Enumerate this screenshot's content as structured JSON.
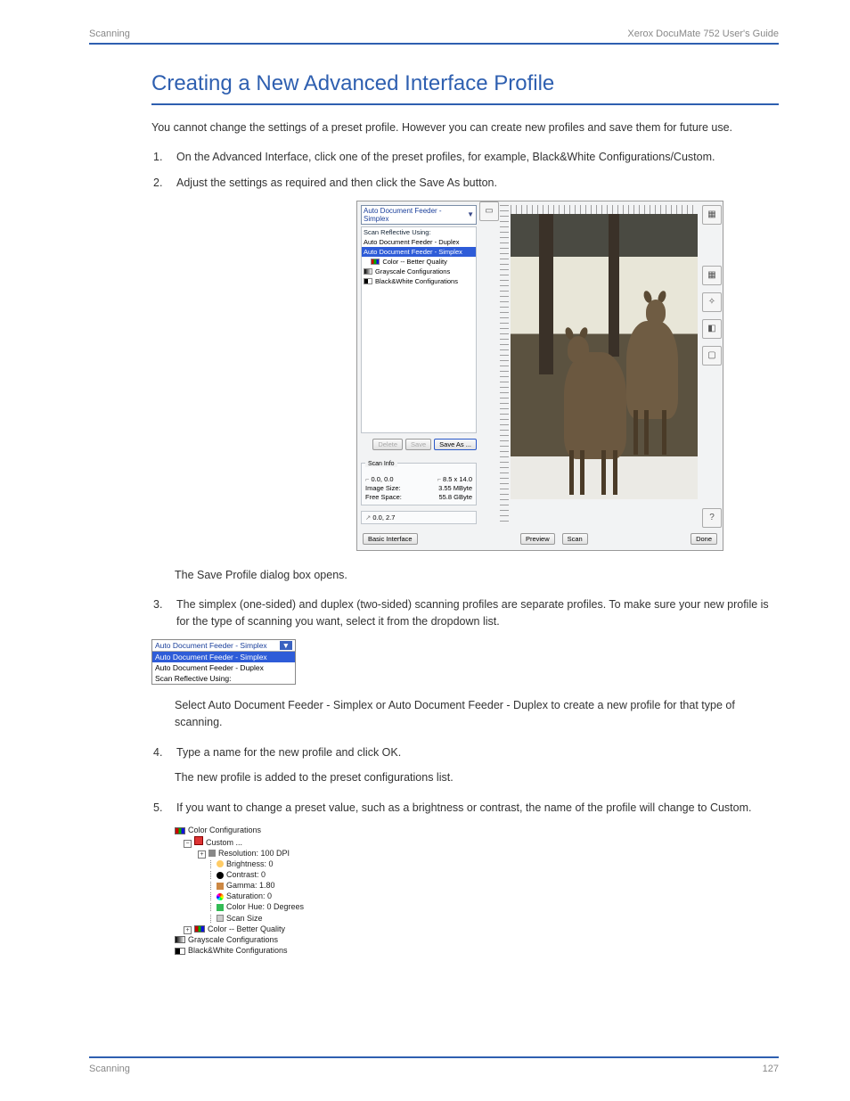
{
  "header": {
    "left": "Scanning",
    "right": "Xerox DocuMate 752 User's Guide"
  },
  "section_title": "Creating a New Advanced Interface Profile",
  "intro": "You cannot change the settings of a preset profile. However you can create new profiles and save them for future use.",
  "step1": "On the Advanced Interface, click one of the preset profiles, for example, Black&White Configurations/Custom.",
  "step2": "Adjust the settings as required and then click the Save As button.",
  "after_shot": "The Save Profile dialog box opens.",
  "step3_a": "The simplex (one-sided) and duplex (two-sided) scanning profiles are separate profiles. To make sure your new profile is for the type of scanning you want, select it from the dropdown list.",
  "step3_b": "Select Auto Document Feeder - Simplex or Auto Document Feeder - Duplex to create a new profile for that type of scanning.",
  "step4": "Type a name for the new profile and click OK.",
  "step4_after": "The new profile is added to the preset configurations list.",
  "step5": "If you want to change a preset value, such as a brightness or contrast, the name of the profile will change to Custom.",
  "footer": {
    "left": "Scanning",
    "right": "127"
  },
  "shot": {
    "combo_value": "Auto Document Feeder - Simplex",
    "list": {
      "header": "Scan Reflective Using:",
      "r1": "Auto Document Feeder - Duplex",
      "sel": "Auto Document Feeder - Simplex",
      "r2": "Color -- Better Quality",
      "r3": "Grayscale Configurations",
      "r4": "Black&White Configurations"
    },
    "btn_delete": "Delete",
    "btn_save": "Save",
    "btn_saveas": "Save As ...",
    "scaninfo_title": "Scan Info",
    "origin": "0.0, 0.0",
    "dims": "8.5 x 14.0",
    "imgsize_label": "Image Size:",
    "imgsize": "3.55 MByte",
    "free_label": "Free Space:",
    "free": "55.8 GByte",
    "cursor": "0.0, 2.7",
    "btn_basic": "Basic Interface",
    "btn_preview": "Preview",
    "btn_scan": "Scan",
    "btn_done": "Done"
  },
  "mini": {
    "header": "Auto Document Feeder - Simplex",
    "r1": "Auto Document Feeder - Simplex",
    "r2": "Auto Document Feeder - Duplex",
    "r3": "Scan Reflective Using:"
  },
  "tree": {
    "t0": "Color Configurations",
    "t1": "Custom ...",
    "res": "Resolution: 100 DPI",
    "bri": "Brightness: 0",
    "con": "Contrast: 0",
    "gam": "Gamma: 1.80",
    "sat": "Saturation: 0",
    "hue": "Color Hue: 0 Degrees",
    "siz": "Scan Size",
    "better": "Color -- Better Quality",
    "gray": "Grayscale Configurations",
    "bw": "Black&White Configurations"
  },
  "colors": {
    "rgb": "linear-gradient(90deg,#c00 33%,#0a0 33% 66%,#11d 66%)",
    "gray_sw": "linear-gradient(90deg,#000,#fff)",
    "bw_sw": "linear-gradient(90deg,#000 50%,#fff 50%)"
  }
}
